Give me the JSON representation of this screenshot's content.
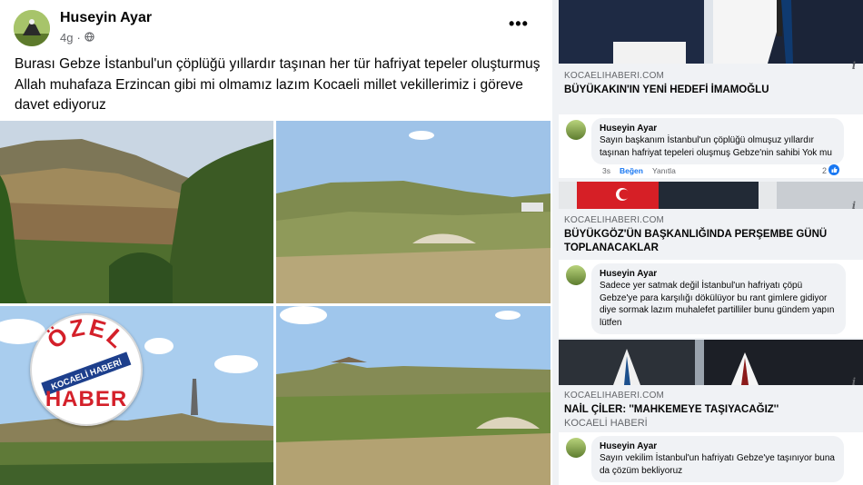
{
  "post": {
    "author": "Huseyin Ayar",
    "time": "4g",
    "text": "Burası Gebze İstanbul'un çöplüğü yıllardır taşınan her tür hafriyat tepeler oluşturmuş Allah muhafaza Erzincan gibi mi olmamız lazım Kocaeli millet vekillerimiz i göreve davet ediyoruz",
    "badge": {
      "line1": "ÖZEL",
      "line2": "KOCAELİ HABERİ",
      "line3": "HABER"
    }
  },
  "cards": [
    {
      "domain": "KOCAELIHABERI.COM",
      "title": "BÜYÜKAKIN'IN YENİ HEDEFİ İMAMOĞLU",
      "comment": {
        "name": "Huseyin Ayar",
        "text": "Sayın başkanım İstanbul'un çöplüğü olmuşuz yıllardır taşınan hafriyat tepeleri oluşmuş Gebze'nin sahibi Yok mu",
        "time": "3s",
        "like": "Beğen",
        "reply": "Yanıtla",
        "reactions": "2"
      }
    },
    {
      "domain": "KOCAELIHABERI.COM",
      "title": "BÜYÜKGÖZ'ÜN BAŞKANLIĞINDA PERŞEMBE GÜNÜ TOPLANACAKLAR",
      "comment": {
        "name": "Huseyin Ayar",
        "text": "Sadece yer satmak değil İstanbul'un hafriyatı çöpü Gebze'ye para karşılığı dökülüyor bu rant gimlere gidiyor diye sormak lazım muhalefet partilliler bunu gündem yapın lütfen"
      }
    },
    {
      "domain": "KOCAELIHABERI.COM",
      "title": "NAİL ÇİLER: ''MAHKEMEYE TAŞIYACAĞIZ''",
      "subtitle": "KOCAELİ HABERİ",
      "comment": {
        "name": "Huseyin Ayar",
        "text": "Sayın vekilim İstanbul'un hafriyatı Gebze'ye taşınıyor buna da çözüm bekliyoruz"
      }
    }
  ],
  "icons": {
    "more": "more-options-icon",
    "globe": "globe-icon",
    "info": "info-icon",
    "like": "like-reaction-icon"
  },
  "colors": {
    "link": "#1877f2",
    "muted": "#65676b",
    "text": "#050505",
    "badge_red": "#d4202a",
    "badge_blue": "#1d3f8c"
  }
}
